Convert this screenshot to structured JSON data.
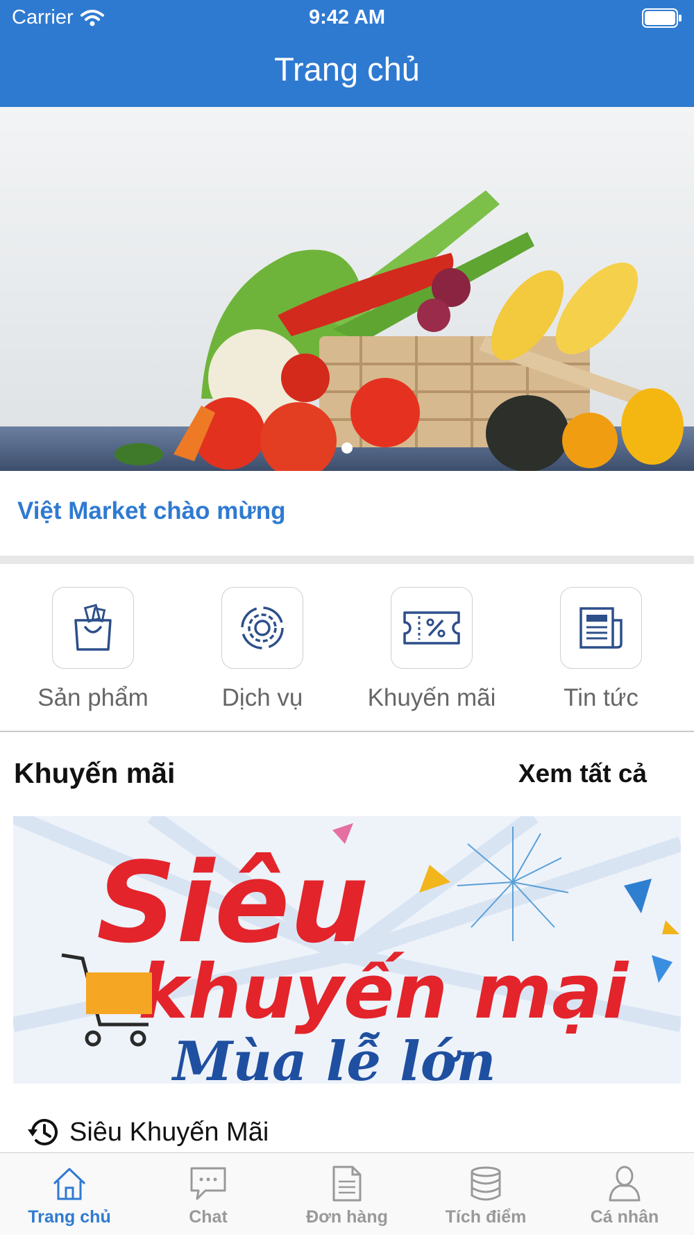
{
  "status_bar": {
    "carrier": "Carrier",
    "time": "9:42 AM"
  },
  "nav": {
    "title": "Trang chủ"
  },
  "welcome": "Việt Market chào mừng",
  "categories": [
    {
      "label": "Sản phẩm",
      "icon": "shopping-bag-icon"
    },
    {
      "label": "Dịch vụ",
      "icon": "gear-icon"
    },
    {
      "label": "Khuyến mãi",
      "icon": "coupon-icon"
    },
    {
      "label": "Tin tức",
      "icon": "newspaper-icon"
    }
  ],
  "promotions": {
    "title": "Khuyến mãi",
    "see_all": "Xem tất cả",
    "banner": {
      "line1": "Siêu",
      "line2": "khuyến mại",
      "line3": "Mùa lễ lớn"
    },
    "item_caption": "Siêu Khuyến Mãi"
  },
  "tabs": [
    {
      "label": "Trang chủ",
      "icon": "home-icon",
      "active": true
    },
    {
      "label": "Chat",
      "icon": "chat-icon",
      "active": false
    },
    {
      "label": "Đơn hàng",
      "icon": "document-icon",
      "active": false
    },
    {
      "label": "Tích điểm",
      "icon": "database-icon",
      "active": false
    },
    {
      "label": "Cá nhân",
      "icon": "user-icon",
      "active": false
    }
  ],
  "colors": {
    "primary": "#2f7ad1",
    "inactive": "#999999",
    "promo_red": "#e3242b"
  }
}
